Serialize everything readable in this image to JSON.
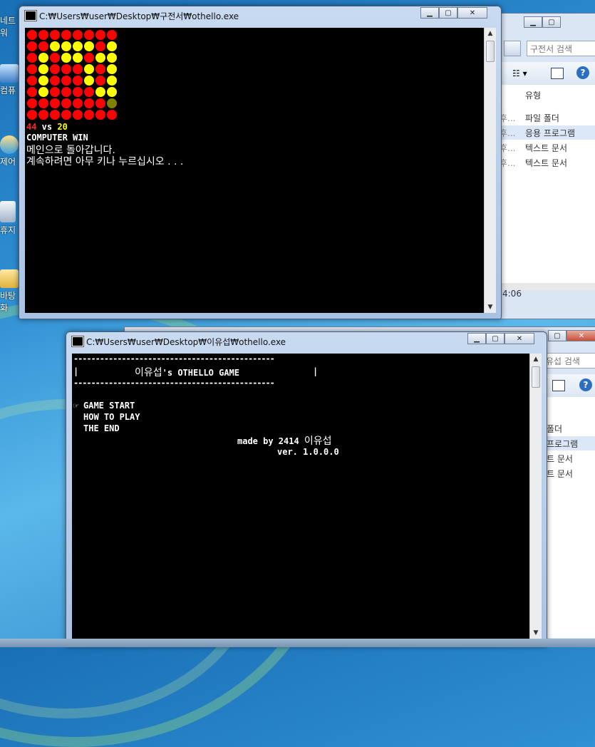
{
  "desktop": {
    "icons": [
      {
        "label": "네트워"
      },
      {
        "label": "컴퓨"
      },
      {
        "label": "제어"
      },
      {
        "label": "휴지"
      },
      {
        "label": "바탕화"
      }
    ]
  },
  "explorer_top": {
    "search_placeholder": "구전서 검색",
    "column_type": "유형",
    "rows": [
      {
        "mod": "후...",
        "type": "파일 폴더"
      },
      {
        "mod": "후...",
        "type": "응용 프로그램"
      },
      {
        "mod": "후...",
        "type": "텍스트 문서"
      },
      {
        "mod": "후...",
        "type": "텍스트 문서"
      }
    ],
    "time_fragment": "4:06"
  },
  "explorer_bottom": {
    "search_placeholder": "유섭 검색",
    "rows": [
      {
        "type": "폴더"
      },
      {
        "type": "프로그램"
      },
      {
        "type": "트 문서"
      },
      {
        "type": "트 문서"
      }
    ]
  },
  "window1": {
    "title": "C:₩Users₩user₩Desktop₩구전서₩othello.exe",
    "board": [
      "RRRRRRRR",
      "RRYYYYRY",
      "RYRYYRYY",
      "RYRRRYRY",
      "RYRRRYRY",
      "RYRRRRYY",
      "RRRRRRRO",
      "RRRRRRRR"
    ],
    "score_red": "44",
    "score_vs": " vs ",
    "score_yellow": "20",
    "result": "COMPUTER WIN",
    "line_back": "메인으로 돌아갑니다.",
    "line_continue": "계속하려면 아무 키나 누르십시오 . . ."
  },
  "window2": {
    "title": "C:₩Users₩user₩Desktop₩이유섭₩othello.exe",
    "rule_line": "----------------------------------------------",
    "header_left": "|",
    "header_title_kor": "이유섭",
    "header_title_rest": "'s OTHELLO GAME",
    "header_right": "|",
    "pointer": "☞",
    "menu": [
      "GAME START",
      "HOW TO PLAY",
      "THE END"
    ],
    "credit_prefix": "made by 2414 ",
    "credit_name": "이유섭",
    "version": "ver. 1.0.0.0"
  },
  "colors": {
    "red": "#ff0000",
    "yellow": "#ffff00",
    "olive": "#808000"
  },
  "icons": [
    "minimize-icon",
    "maximize-icon",
    "close-icon",
    "console-app-icon",
    "scroll-up-icon",
    "scroll-down-icon"
  ]
}
